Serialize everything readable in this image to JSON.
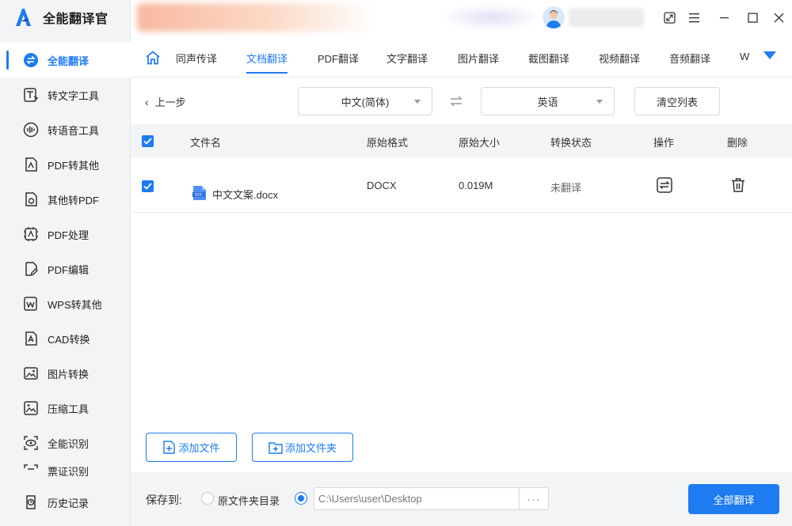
{
  "app": {
    "name": "全能翻译官"
  },
  "colors": {
    "accent": "#1e7bf0",
    "sidebar_bg": "#f3f4f6",
    "header_bg": "#f3f4f6"
  },
  "sidebar": {
    "items": [
      {
        "label": "全能翻译",
        "icon": "translate-icon",
        "active": true
      },
      {
        "label": "转文字工具",
        "icon": "text-convert-icon"
      },
      {
        "label": "转语音工具",
        "icon": "voice-wave-icon"
      },
      {
        "label": "PDF转其他",
        "icon": "pdf-export-icon"
      },
      {
        "label": "其他转PDF",
        "icon": "pdf-import-icon"
      },
      {
        "label": "PDF处理",
        "icon": "pdf-process-icon"
      },
      {
        "label": "PDF编辑",
        "icon": "pdf-edit-icon"
      },
      {
        "label": "WPS转其他",
        "icon": "wps-icon"
      },
      {
        "label": "CAD转换",
        "icon": "cad-icon"
      },
      {
        "label": "图片转换",
        "icon": "image-convert-icon"
      },
      {
        "label": "压缩工具",
        "icon": "compress-icon"
      },
      {
        "label": "全能识别",
        "icon": "scan-eye-icon"
      },
      {
        "label": "票证识别",
        "icon": "ticket-scan-icon"
      }
    ],
    "history": {
      "label": "历史记录",
      "icon": "history-icon"
    }
  },
  "tabs": [
    {
      "label": "同声传译"
    },
    {
      "label": "文档翻译",
      "active": true
    },
    {
      "label": "PDF翻译"
    },
    {
      "label": "文字翻译"
    },
    {
      "label": "图片翻译"
    },
    {
      "label": "截图翻译"
    },
    {
      "label": "视频翻译"
    },
    {
      "label": "音频翻译"
    },
    {
      "label": "W"
    }
  ],
  "toolbar": {
    "back_label": "上一步",
    "source_lang": "中文(简体)",
    "target_lang": "英语",
    "clear_label": "清空列表"
  },
  "table": {
    "headers": {
      "filename": "文件名",
      "format": "原始格式",
      "size": "原始大小",
      "status": "转换状态",
      "action": "操作",
      "delete": "删除"
    },
    "rows": [
      {
        "filename": "中文文案.docx",
        "format": "DOCX",
        "size": "0.019M",
        "status": "未翻译",
        "checked": true,
        "file_icon_text": "DOC"
      }
    ]
  },
  "actions": {
    "add_file": "添加文件",
    "add_folder": "添加文件夹"
  },
  "footer": {
    "save_to_label": "保存到:",
    "option_original": "原文件夹目录",
    "path_value": "C:\\Users\\user\\Desktop",
    "more_label": "···",
    "translate_all": "全部翻译"
  }
}
